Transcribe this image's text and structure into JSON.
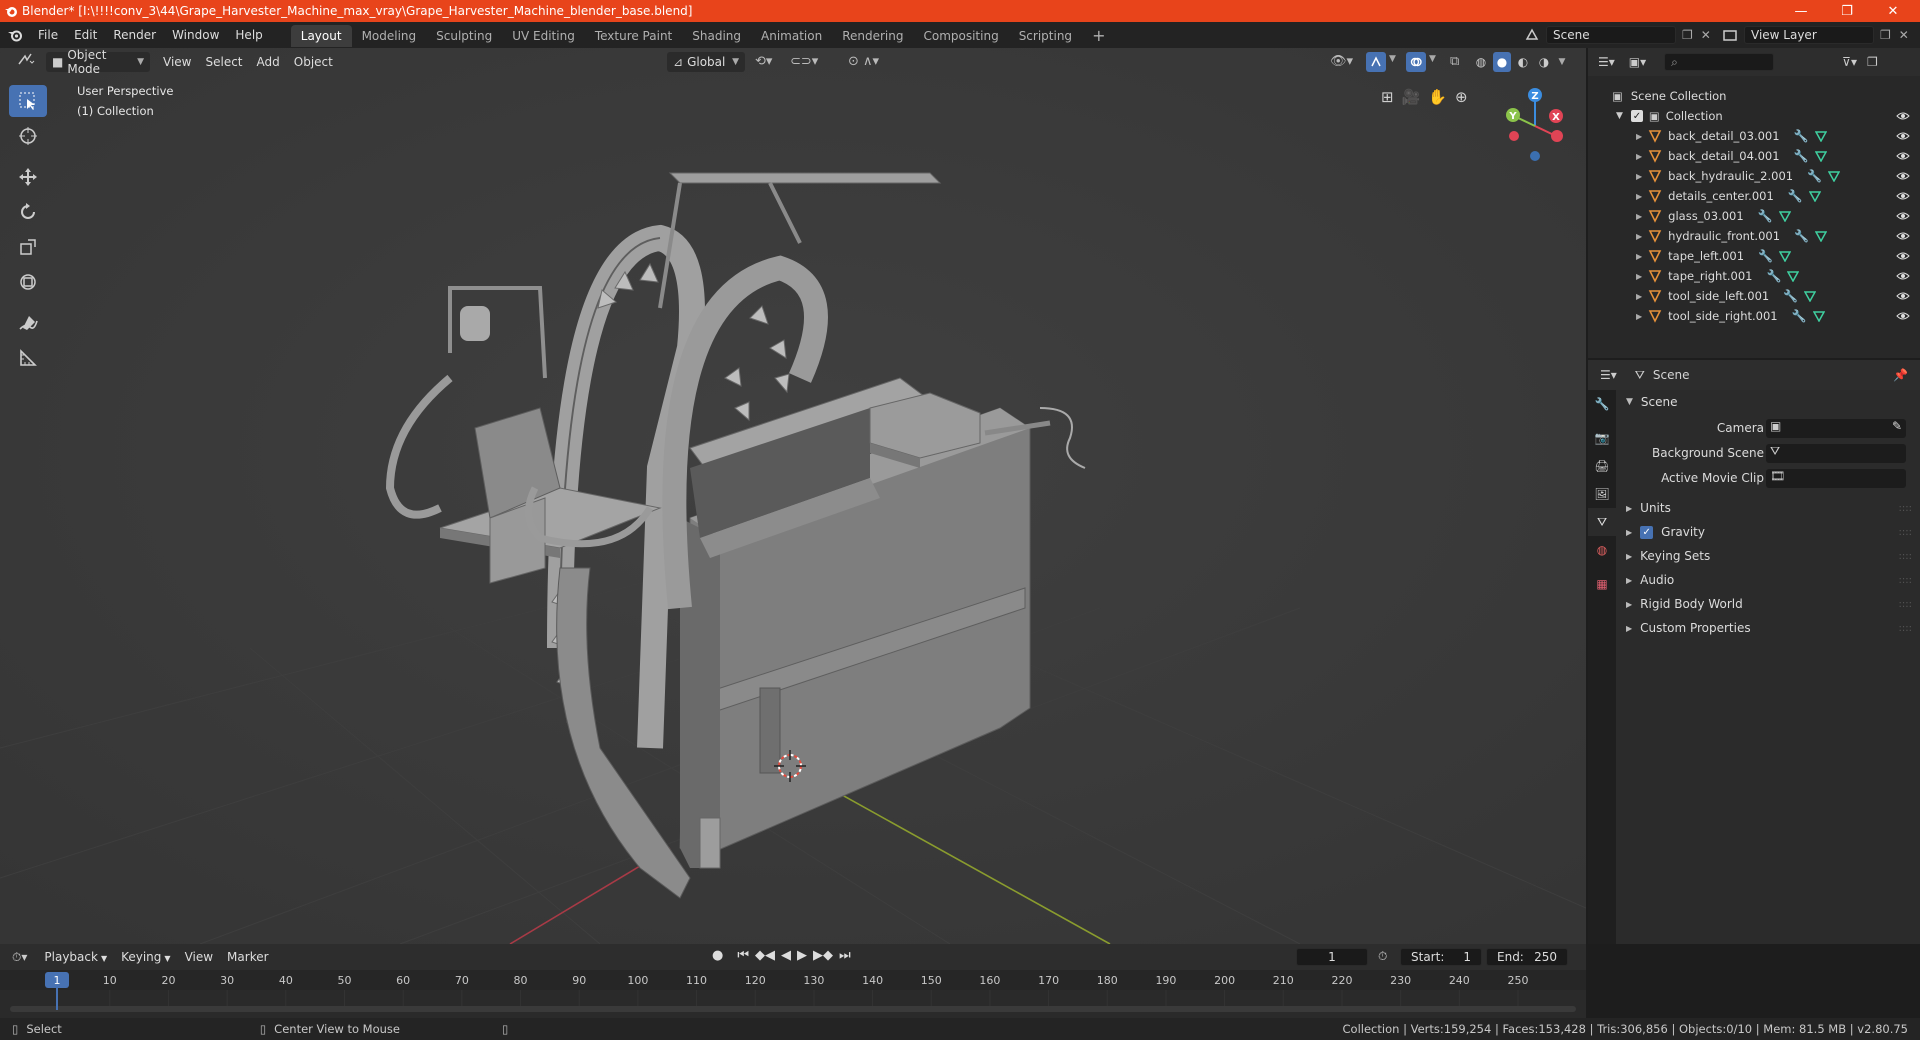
{
  "title_bar": {
    "text": "Blender* [I:\\!!!!conv_3\\44\\Grape_Harvester_Machine_max_vray\\Grape_Harvester_Machine_blender_base.blend]",
    "controls": [
      "—",
      "❐",
      "✕"
    ]
  },
  "menu": [
    "File",
    "Edit",
    "Render",
    "Window",
    "Help"
  ],
  "workspace_tabs": [
    "Layout",
    "Modeling",
    "Sculpting",
    "UV Editing",
    "Texture Paint",
    "Shading",
    "Animation",
    "Rendering",
    "Compositing",
    "Scripting"
  ],
  "active_workspace": "Layout",
  "scene_selector": "Scene",
  "view_layer": "View Layer",
  "viewport_header": {
    "mode": "Object Mode",
    "menus": [
      "View",
      "Select",
      "Add",
      "Object"
    ],
    "transform_orientation": "Global"
  },
  "viewport": {
    "perspective_label": "User Perspective",
    "collection_label": "(1) Collection",
    "gizmo_axes": {
      "x": "X",
      "y": "Y",
      "z": "Z"
    }
  },
  "outliner": {
    "root": "Scene Collection",
    "collection": "Collection",
    "objects": [
      "back_detail_03.001",
      "back_detail_04.001",
      "back_hydraulic_2.001",
      "details_center.001",
      "glass_03.001",
      "hydraulic_front.001",
      "tape_left.001",
      "tape_right.001",
      "tool_side_left.001",
      "tool_side_right.001"
    ]
  },
  "properties": {
    "context": "Scene",
    "panel_title": "Scene",
    "fields": [
      {
        "label": "Camera"
      },
      {
        "label": "Background Scene"
      },
      {
        "label": "Active Movie Clip"
      }
    ],
    "sections": [
      "Units",
      "Gravity",
      "Keying Sets",
      "Audio",
      "Rigid Body World",
      "Custom Properties"
    ],
    "gravity_checked": true
  },
  "timeline": {
    "menus": [
      "Playback",
      "Keying",
      "View",
      "Marker"
    ],
    "current_frame": "1",
    "start_label": "Start:",
    "start": "1",
    "end_label": "End:",
    "end": "250",
    "ruler": [
      "1",
      "10",
      "20",
      "30",
      "40",
      "50",
      "60",
      "70",
      "80",
      "90",
      "100",
      "110",
      "120",
      "130",
      "140",
      "150",
      "160",
      "170",
      "180",
      "190",
      "200",
      "210",
      "220",
      "230",
      "240",
      "250"
    ]
  },
  "status_bar": {
    "left_action": "Select",
    "middle_action": "Center View to Mouse",
    "stats": "Collection | Verts:159,254 | Faces:153,428 | Tris:306,856 | Objects:0/10 | Mem: 81.5 MB | v2.80.75"
  },
  "colors": {
    "title_bar": "#e8441b",
    "active_blue": "#4772b3",
    "object_orange": "#e6913a",
    "x_axis": "#e04455",
    "y_axis": "#8bc34a",
    "z_axis": "#3b8de0"
  }
}
